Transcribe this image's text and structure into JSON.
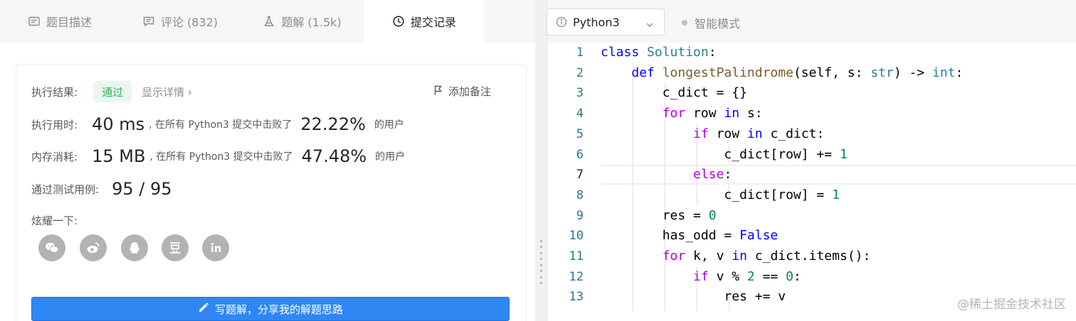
{
  "tabs": [
    {
      "label": "题目描述",
      "icon": "description-icon"
    },
    {
      "label": "评论 (832)",
      "icon": "comment-icon"
    },
    {
      "label": "题解 (1.5k)",
      "icon": "flask-icon"
    },
    {
      "label": "提交记录",
      "icon": "clock-icon",
      "active": true
    }
  ],
  "result": {
    "label": "执行结果:",
    "status": "通过",
    "details": "显示详情 ›",
    "note": "添加备注"
  },
  "runtime": {
    "label": "执行用时:",
    "value": "40 ms",
    "mid": ", 在所有 Python3 提交中击败了",
    "percent": "22.22%",
    "suffix": "的用户"
  },
  "memory": {
    "label": "内存消耗:",
    "value": "15 MB",
    "mid": ", 在所有 Python3 提交中击败了",
    "percent": "47.48%",
    "suffix": "的用户"
  },
  "tests": {
    "label": "通过测试用例:",
    "value": "95 / 95"
  },
  "share": {
    "label": "炫耀一下:",
    "icons": [
      "wechat-icon",
      "weibo-icon",
      "qq-icon",
      "douban-icon",
      "linkedin-icon"
    ]
  },
  "write_button": "写题解，分享我的解题思路",
  "editor": {
    "language": "Python3",
    "mode": "智能模式",
    "line_numbers": [
      "1",
      "2",
      "3",
      "4",
      "5",
      "6",
      "7",
      "8",
      "9",
      "10",
      "11",
      "12",
      "13"
    ]
  },
  "watermark": "@稀土掘金技术社区",
  "colors": {
    "accent": "#2f87f3",
    "pass_text": "#2db55d",
    "pass_bg": "#eaf7ef",
    "keyword": "#0000ff",
    "control": "#af00db",
    "number": "#098658",
    "line_number": "#237893"
  }
}
